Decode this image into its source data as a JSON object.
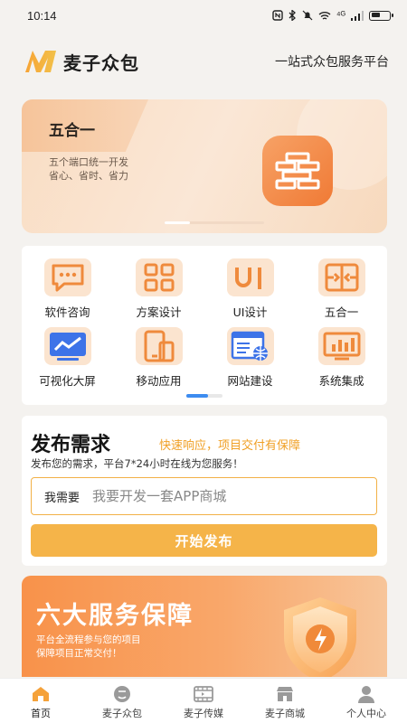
{
  "status_bar": {
    "time": "10:14",
    "network": "⁴ᴳ",
    "battery_level": 0.55
  },
  "header": {
    "logo_text": "麦子众包",
    "slogan": "一站式众包服务平台"
  },
  "banner": {
    "title": "五合一",
    "desc_line1": "五个端口统一开发",
    "desc_line2": "省心、省时、省力",
    "icon": "wall-icon"
  },
  "services": [
    {
      "label": "软件咨询",
      "icon": "chat-icon"
    },
    {
      "label": "方案设计",
      "icon": "grid-icon"
    },
    {
      "label": "UI设计",
      "icon": "ui-icon"
    },
    {
      "label": "五合一",
      "icon": "merge-icon"
    },
    {
      "label": "可视化大屏",
      "icon": "chart-screen-icon"
    },
    {
      "label": "移动应用",
      "icon": "mobile-icon"
    },
    {
      "label": "网站建设",
      "icon": "web-icon"
    },
    {
      "label": "系统集成",
      "icon": "system-icon"
    }
  ],
  "publish": {
    "title": "发布需求",
    "tagline": "快速响应，项目交付有保障",
    "desc": "发布您的需求，平台7*24小时在线为您服务！",
    "need_label": "我需要",
    "placeholder": "我要开发一套APP商城",
    "button": "开始发布"
  },
  "guarantee": {
    "title": "六大服务保障",
    "desc_line1": "平台全流程参与您的项目",
    "desc_line2": "保障项目正常交付！"
  },
  "tabs": [
    {
      "label": "首页",
      "icon": "home-icon",
      "active": true
    },
    {
      "label": "麦子众包",
      "icon": "crowd-icon",
      "active": false
    },
    {
      "label": "麦子传媒",
      "icon": "media-icon",
      "active": false
    },
    {
      "label": "麦子商城",
      "icon": "shop-icon",
      "active": false
    },
    {
      "label": "个人中心",
      "icon": "person-icon",
      "active": false
    }
  ],
  "colors": {
    "accent": "#f5b449",
    "orange": "#f07a35",
    "icon_bg": "#fbe4cf",
    "active_tab": "#f5a23a",
    "inactive_tab": "#9a9a9a"
  }
}
